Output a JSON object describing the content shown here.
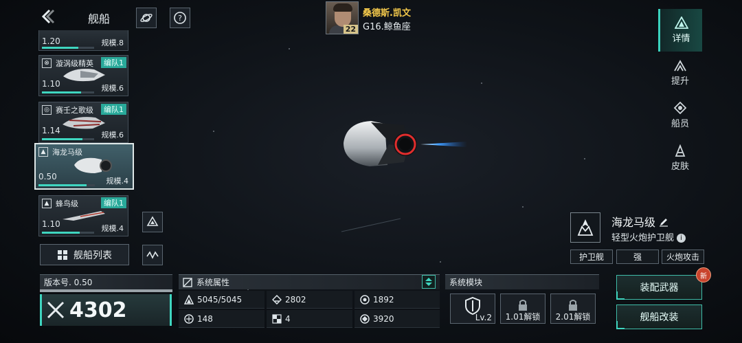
{
  "header": {
    "title": "舰船"
  },
  "captain": {
    "name": "桑德斯.凯文",
    "level": "22",
    "location": "G16.鲸鱼座"
  },
  "ship_list": [
    {
      "name": "",
      "tag": "",
      "version": "1.20",
      "scale": "规模.8",
      "progress": 0.7
    },
    {
      "name": "漩涡级精英",
      "tag": "编队1",
      "version": "1.10",
      "scale": "规模.6",
      "progress": 0.75
    },
    {
      "name": "赛壬之歌级",
      "tag": "编队1",
      "version": "1.14",
      "scale": "规模.6",
      "progress": 0.78
    },
    {
      "name": "海龙马级",
      "tag": "",
      "version": "0.50",
      "scale": "规模.4",
      "progress": 0.85
    },
    {
      "name": "蜂鸟级",
      "tag": "编队1",
      "version": "1.10",
      "scale": "规模.4",
      "progress": 0.72
    }
  ],
  "ship_list_button": "舰船列表",
  "tabs": [
    {
      "label": "详情",
      "icon": "detail-icon"
    },
    {
      "label": "提升",
      "icon": "upgrade-icon"
    },
    {
      "label": "船员",
      "icon": "crew-icon"
    },
    {
      "label": "皮肤",
      "icon": "skin-icon"
    }
  ],
  "ship_info": {
    "name": "海龙马级",
    "class": "轻型火炮护卫舰",
    "tags": [
      "护卫舰",
      "强",
      "火炮攻击"
    ]
  },
  "version": {
    "label": "版本号. 0.50",
    "power": "4302"
  },
  "system_attributes": {
    "title": "系统属性",
    "stats": [
      "5045/5045",
      "2802",
      "1892",
      "148",
      "4",
      "3920"
    ]
  },
  "system_modules": {
    "title": "系统模块",
    "modules": [
      "Lv.2",
      "1.01解锁",
      "2.01解锁"
    ]
  },
  "actions": {
    "equip": "装配武器",
    "modify": "舰船改装",
    "new_badge": "新"
  },
  "colors": {
    "accent": "#3fd6c0",
    "captain_name": "#f2c84b",
    "tag_bg": "#29a99a"
  }
}
